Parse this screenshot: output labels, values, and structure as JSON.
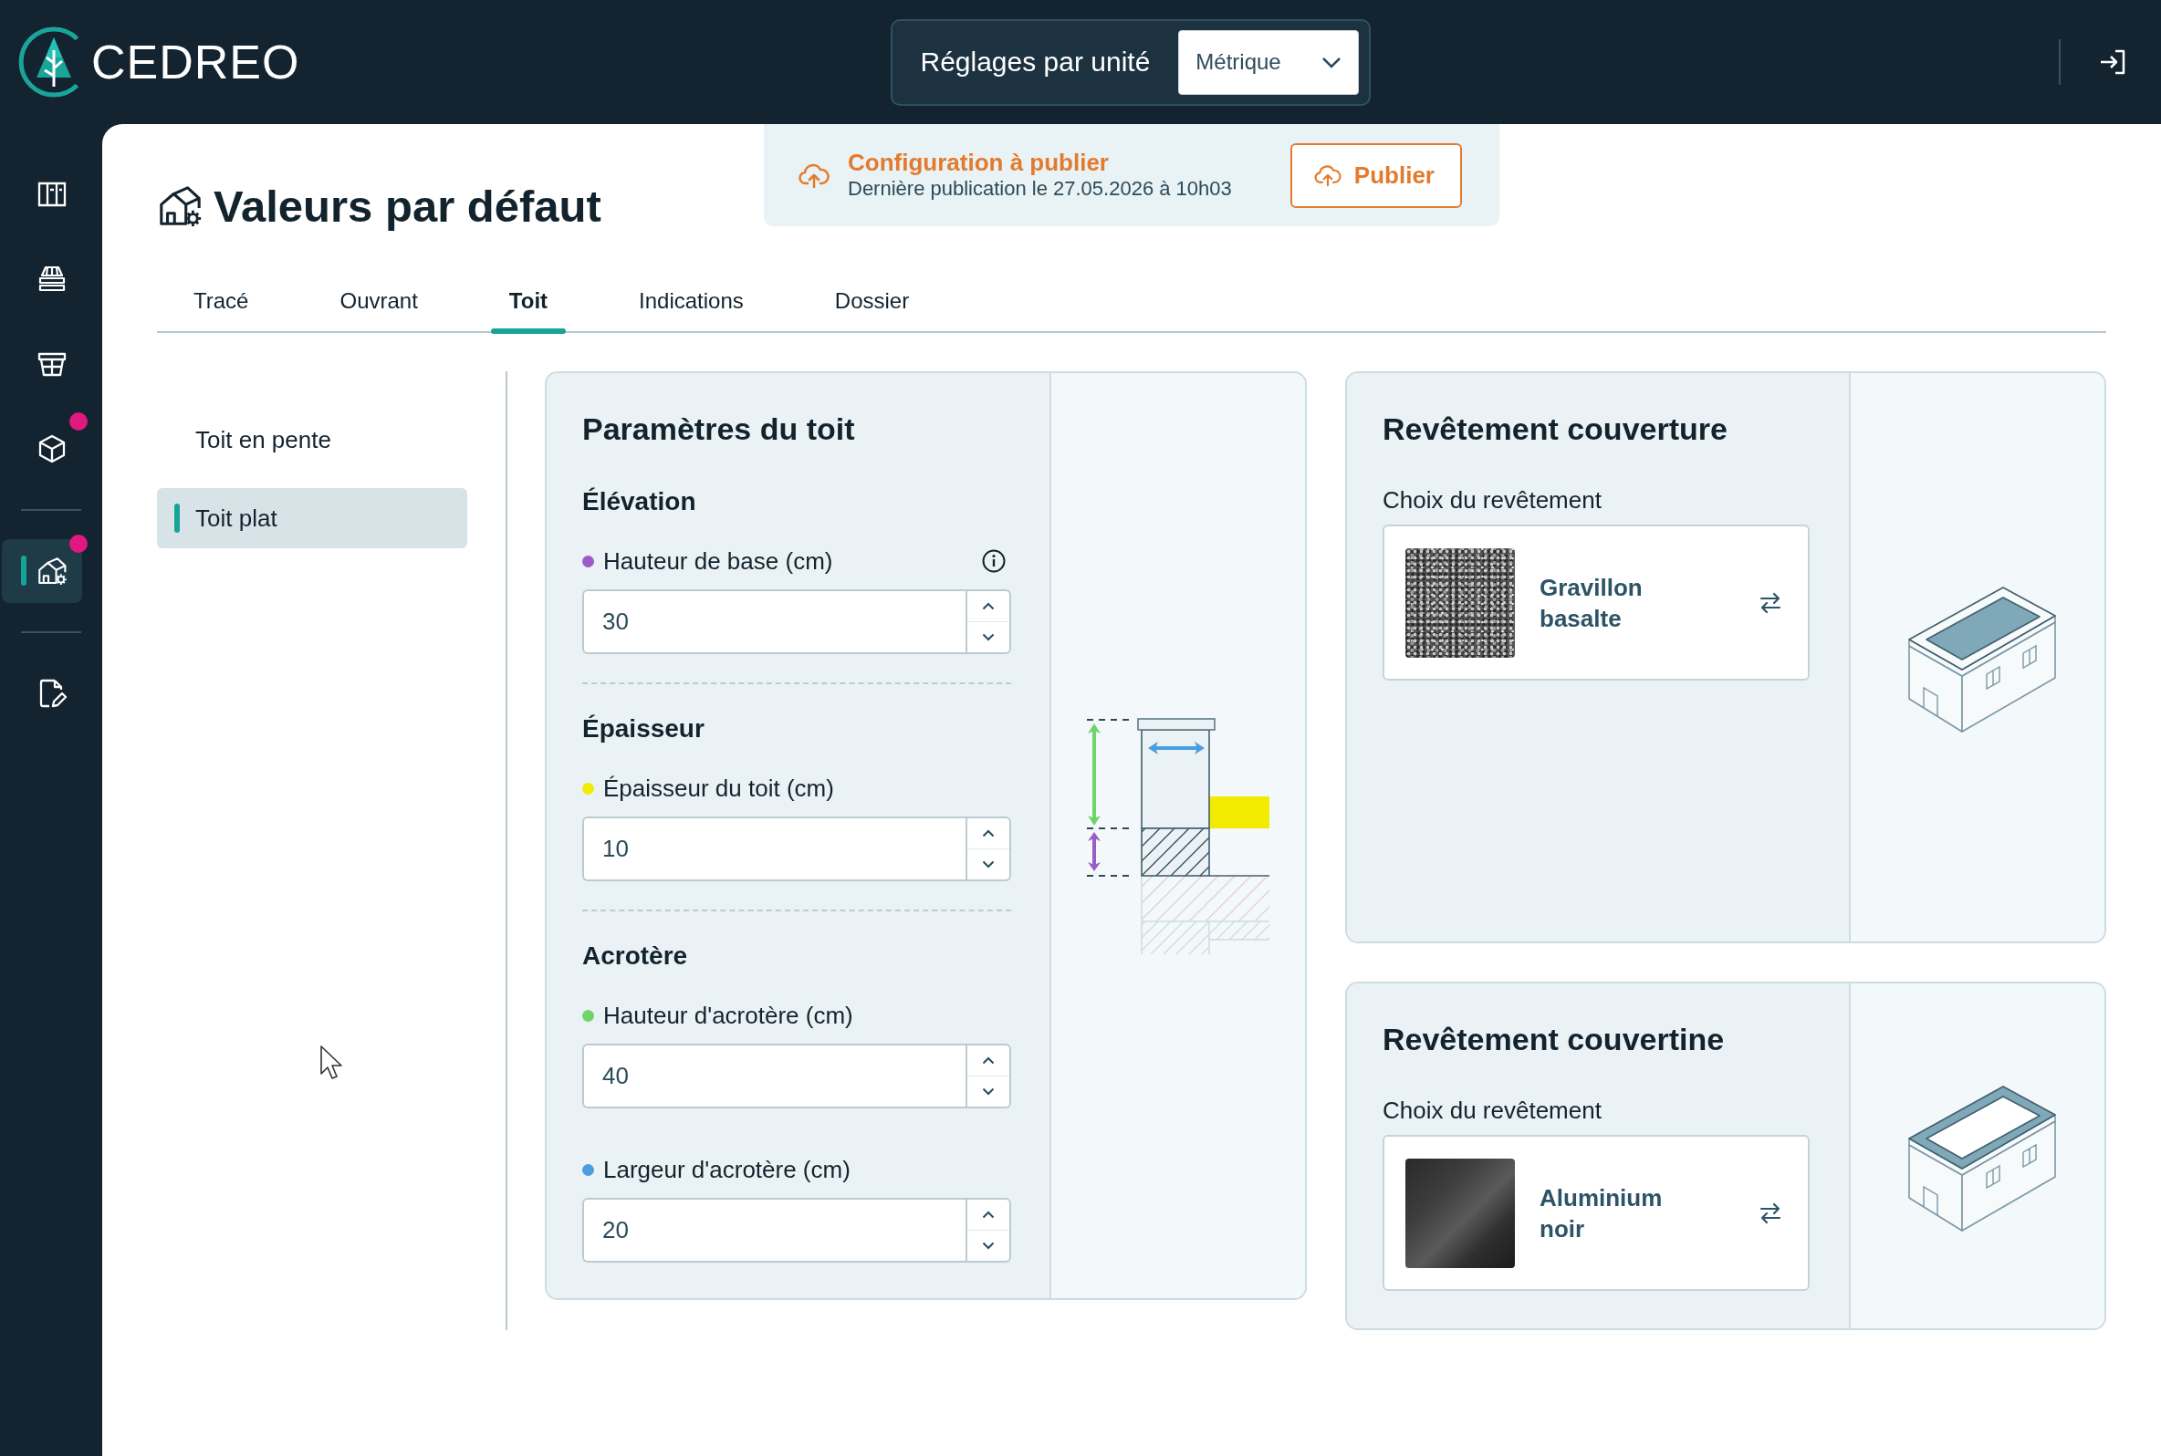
{
  "topbar": {
    "logo": "CEDREO",
    "units": {
      "label": "Réglages par unité",
      "value": "Métrique"
    }
  },
  "sidebar": {
    "groups": [
      {
        "items": [
          {
            "selected": false,
            "notification": false
          },
          {
            "selected": false,
            "notification": false
          },
          {
            "selected": false,
            "notification": false
          },
          {
            "selected": false,
            "notification": true
          }
        ]
      },
      {
        "items": [
          {
            "selected": true,
            "notification": true
          }
        ]
      },
      {
        "items": [
          {
            "selected": false,
            "notification": false
          }
        ]
      }
    ]
  },
  "page": {
    "title": "Valeurs par défaut"
  },
  "publish": {
    "title": "Configuration à publier",
    "subtitle": "Dernière publication le 27.05.2026 à 10h03",
    "button": "Publier"
  },
  "tabs": [
    {
      "label": "Tracé",
      "selected": false
    },
    {
      "label": "Ouvrant",
      "selected": false
    },
    {
      "label": "Toit",
      "selected": true
    },
    {
      "label": "Indications",
      "selected": false
    },
    {
      "label": "Dossier",
      "selected": false
    }
  ],
  "subnav": [
    {
      "label": "Toit en pente",
      "selected": false
    },
    {
      "label": "Toit plat",
      "selected": true
    }
  ],
  "roof_parameters": {
    "title": "Paramètres du toit",
    "sections": [
      {
        "title": "Élévation",
        "fields": [
          {
            "label": "Hauteur de base (cm)",
            "color": "#9b5cc6",
            "value": "30",
            "info": true
          }
        ]
      },
      {
        "title": "Épaisseur",
        "fields": [
          {
            "label": "Épaisseur du toit (cm)",
            "color": "#f2ea00",
            "value": "10",
            "info": false
          }
        ]
      },
      {
        "title": "Acrotère",
        "fields": [
          {
            "label": "Hauteur d'acrotère (cm)",
            "color": "#6fd46a",
            "value": "40",
            "info": false
          },
          {
            "label": "Largeur d'acrotère (cm)",
            "color": "#4a9ee0",
            "value": "20",
            "info": false
          }
        ]
      }
    ]
  },
  "coverings": [
    {
      "kind": "roof",
      "title": "Revêtement couverture",
      "choice_label": "Choix du revêtement",
      "material": "Gravillon basalte"
    },
    {
      "kind": "coping",
      "title": "Revêtement couvertine",
      "choice_label": "Choix du revêtement",
      "material": "Aluminium noir"
    }
  ]
}
